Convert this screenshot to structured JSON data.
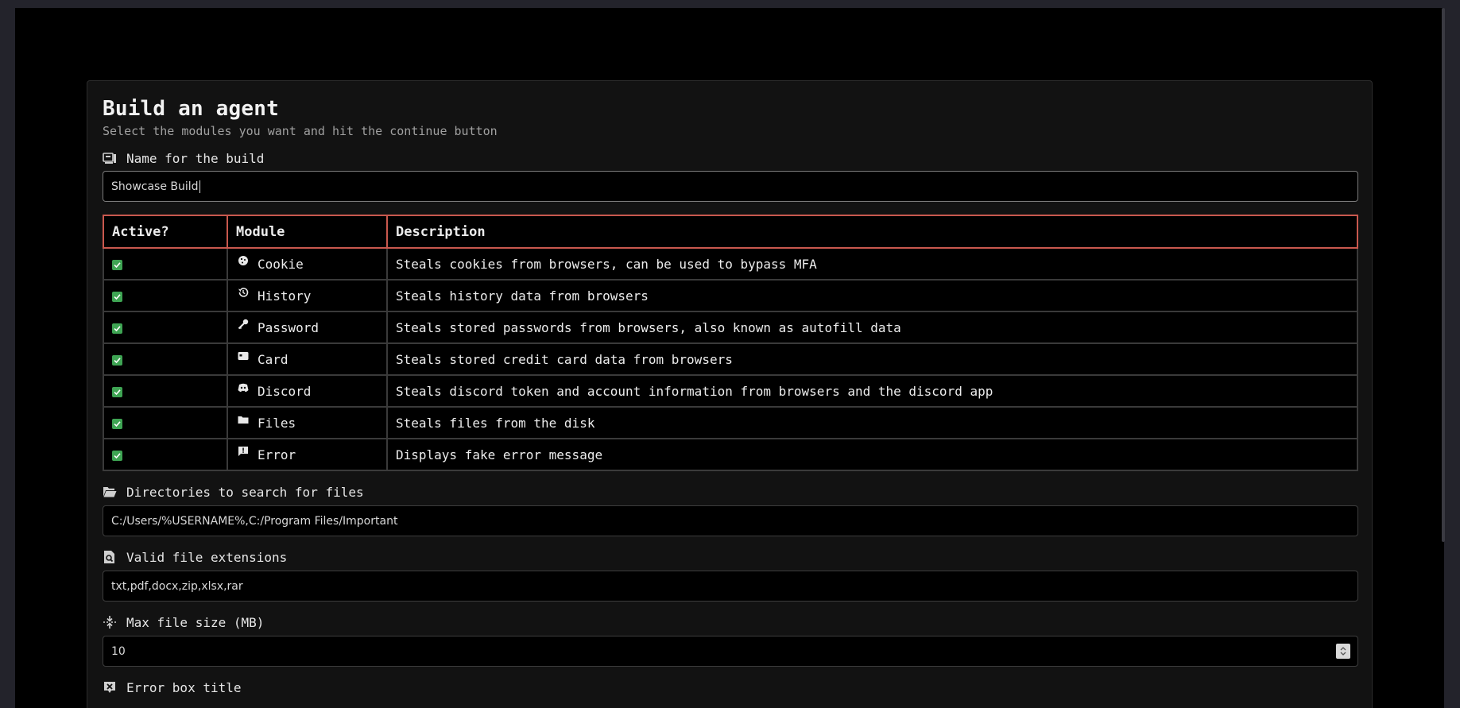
{
  "header": {
    "title": "Build an agent",
    "subtitle": "Select the modules you want and hit the continue button"
  },
  "build_name": {
    "label": "Name for the build",
    "icon": "build-icon",
    "value": "Showcase Build"
  },
  "modules_table": {
    "headers": [
      "Active?",
      "Module",
      "Description"
    ],
    "rows": [
      {
        "active": true,
        "icon": "cookie-icon",
        "module": "Cookie",
        "description": "Steals cookies from browsers, can be used to bypass MFA"
      },
      {
        "active": true,
        "icon": "history-icon",
        "module": "History",
        "description": "Steals history data from browsers"
      },
      {
        "active": true,
        "icon": "key-icon",
        "module": "Password",
        "description": "Steals stored passwords from browsers, also known as autofill data"
      },
      {
        "active": true,
        "icon": "card-icon",
        "module": "Card",
        "description": "Steals stored credit card data from browsers"
      },
      {
        "active": true,
        "icon": "discord-icon",
        "module": "Discord",
        "description": "Steals discord token and account information from browsers and the discord app"
      },
      {
        "active": true,
        "icon": "folder-icon",
        "module": "Files",
        "description": "Steals files from the disk"
      },
      {
        "active": true,
        "icon": "message-alert-icon",
        "module": "Error",
        "description": "Displays fake error message"
      }
    ]
  },
  "directories": {
    "label": "Directories to search for files",
    "icon": "folder-open-icon",
    "value": "C:/Users/%USERNAME%,C:/Program Files/Important"
  },
  "extensions": {
    "label": "Valid file extensions",
    "icon": "file-search-icon",
    "value": "txt,pdf,docx,zip,xlsx,rar"
  },
  "max_size": {
    "label": "Max file size (MB)",
    "icon": "compress-icon",
    "value": "10"
  },
  "error_title": {
    "label": "Error box title",
    "icon": "close-box-icon"
  },
  "colors": {
    "page_bg": "#000000",
    "panel_bg": "#121212",
    "table_header_border": "#c9584e",
    "checkbox": "#3ea453"
  }
}
